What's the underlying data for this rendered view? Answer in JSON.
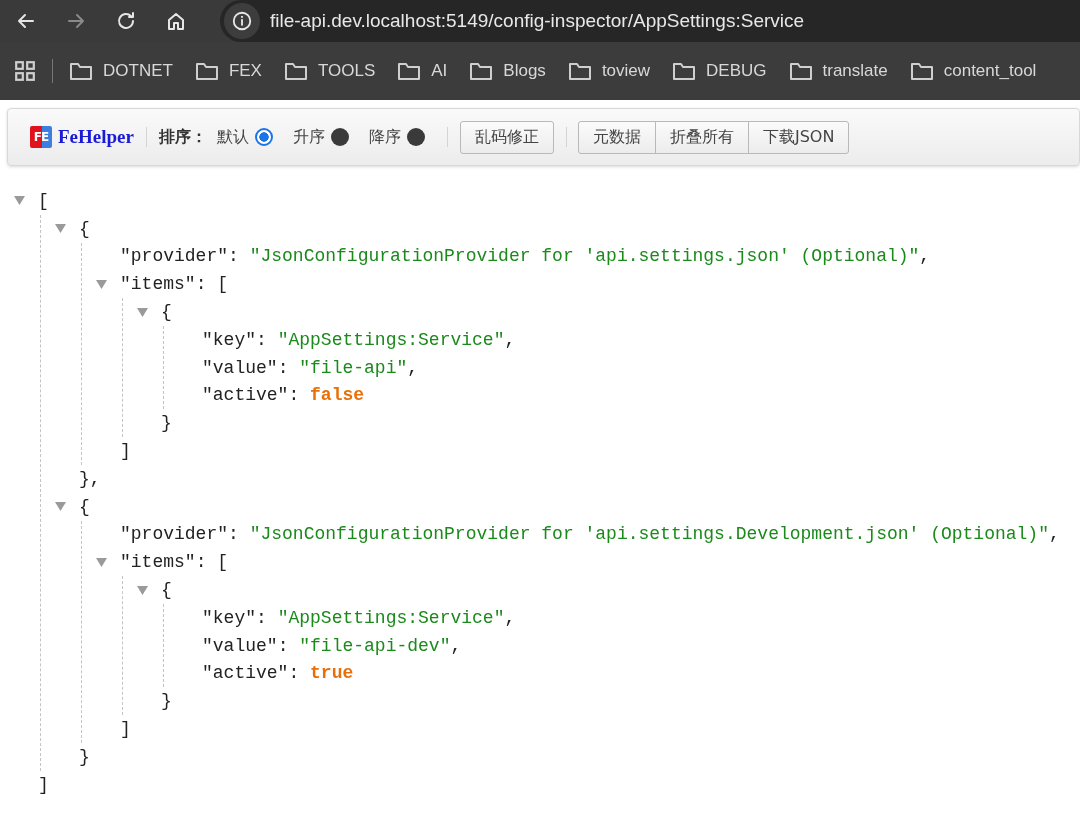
{
  "browser": {
    "nav": [
      {
        "kind": "back",
        "disabled": false
      },
      {
        "kind": "forward",
        "disabled": true
      },
      {
        "kind": "reload",
        "disabled": false
      },
      {
        "kind": "home",
        "disabled": false
      }
    ],
    "url": "file-api.dev.localhost:5149/config-inspector/AppSettings:Service",
    "bookmarks": [
      "DOTNET",
      "FEX",
      "TOOLS",
      "AI",
      "Blogs",
      "toview",
      "DEBUG",
      "translate",
      "content_tool"
    ]
  },
  "toolbar": {
    "logo_mark": "FE",
    "brand": "FeHelper",
    "sort_label": "排序：",
    "sort_options": [
      {
        "label": "默认",
        "selected": true
      },
      {
        "label": "升序",
        "selected": false
      },
      {
        "label": "降序",
        "selected": false
      }
    ],
    "fix_button": "乱码修正",
    "buttons": [
      "元数据",
      "折叠所有",
      "下载JSON"
    ]
  },
  "json_view": {
    "open": "[",
    "expanded": true,
    "close": "]",
    "children": [
      {
        "open": "{",
        "expanded": true,
        "close": "},",
        "children": [
          {
            "key": "\"provider\"",
            "sep": ": ",
            "value": "\"JsonConfigurationProvider for 'api.settings.json' (Optional)\"",
            "kind": "string",
            "comma": ","
          },
          {
            "key": "\"items\"",
            "sep": ": ",
            "open": "[",
            "expanded": true,
            "close": "]",
            "children": [
              {
                "open": "{",
                "expanded": true,
                "close": "}",
                "children": [
                  {
                    "key": "\"key\"",
                    "sep": ": ",
                    "value": "\"AppSettings:Service\"",
                    "kind": "string",
                    "comma": ","
                  },
                  {
                    "key": "\"value\"",
                    "sep": ": ",
                    "value": "\"file-api\"",
                    "kind": "string",
                    "comma": ","
                  },
                  {
                    "key": "\"active\"",
                    "sep": ": ",
                    "value": "false",
                    "kind": "boolean"
                  }
                ]
              }
            ]
          }
        ]
      },
      {
        "open": "{",
        "expanded": true,
        "close": "}",
        "children": [
          {
            "key": "\"provider\"",
            "sep": ": ",
            "value": "\"JsonConfigurationProvider for 'api.settings.Development.json' (Optional)\"",
            "kind": "string",
            "comma": ","
          },
          {
            "key": "\"items\"",
            "sep": ": ",
            "open": "[",
            "expanded": true,
            "close": "]",
            "children": [
              {
                "open": "{",
                "expanded": true,
                "close": "}",
                "children": [
                  {
                    "key": "\"key\"",
                    "sep": ": ",
                    "value": "\"AppSettings:Service\"",
                    "kind": "string",
                    "comma": ","
                  },
                  {
                    "key": "\"value\"",
                    "sep": ": ",
                    "value": "\"file-api-dev\"",
                    "kind": "string",
                    "comma": ","
                  },
                  {
                    "key": "\"active\"",
                    "sep": ": ",
                    "value": "true",
                    "kind": "boolean"
                  }
                ]
              }
            ]
          }
        ]
      }
    ]
  }
}
